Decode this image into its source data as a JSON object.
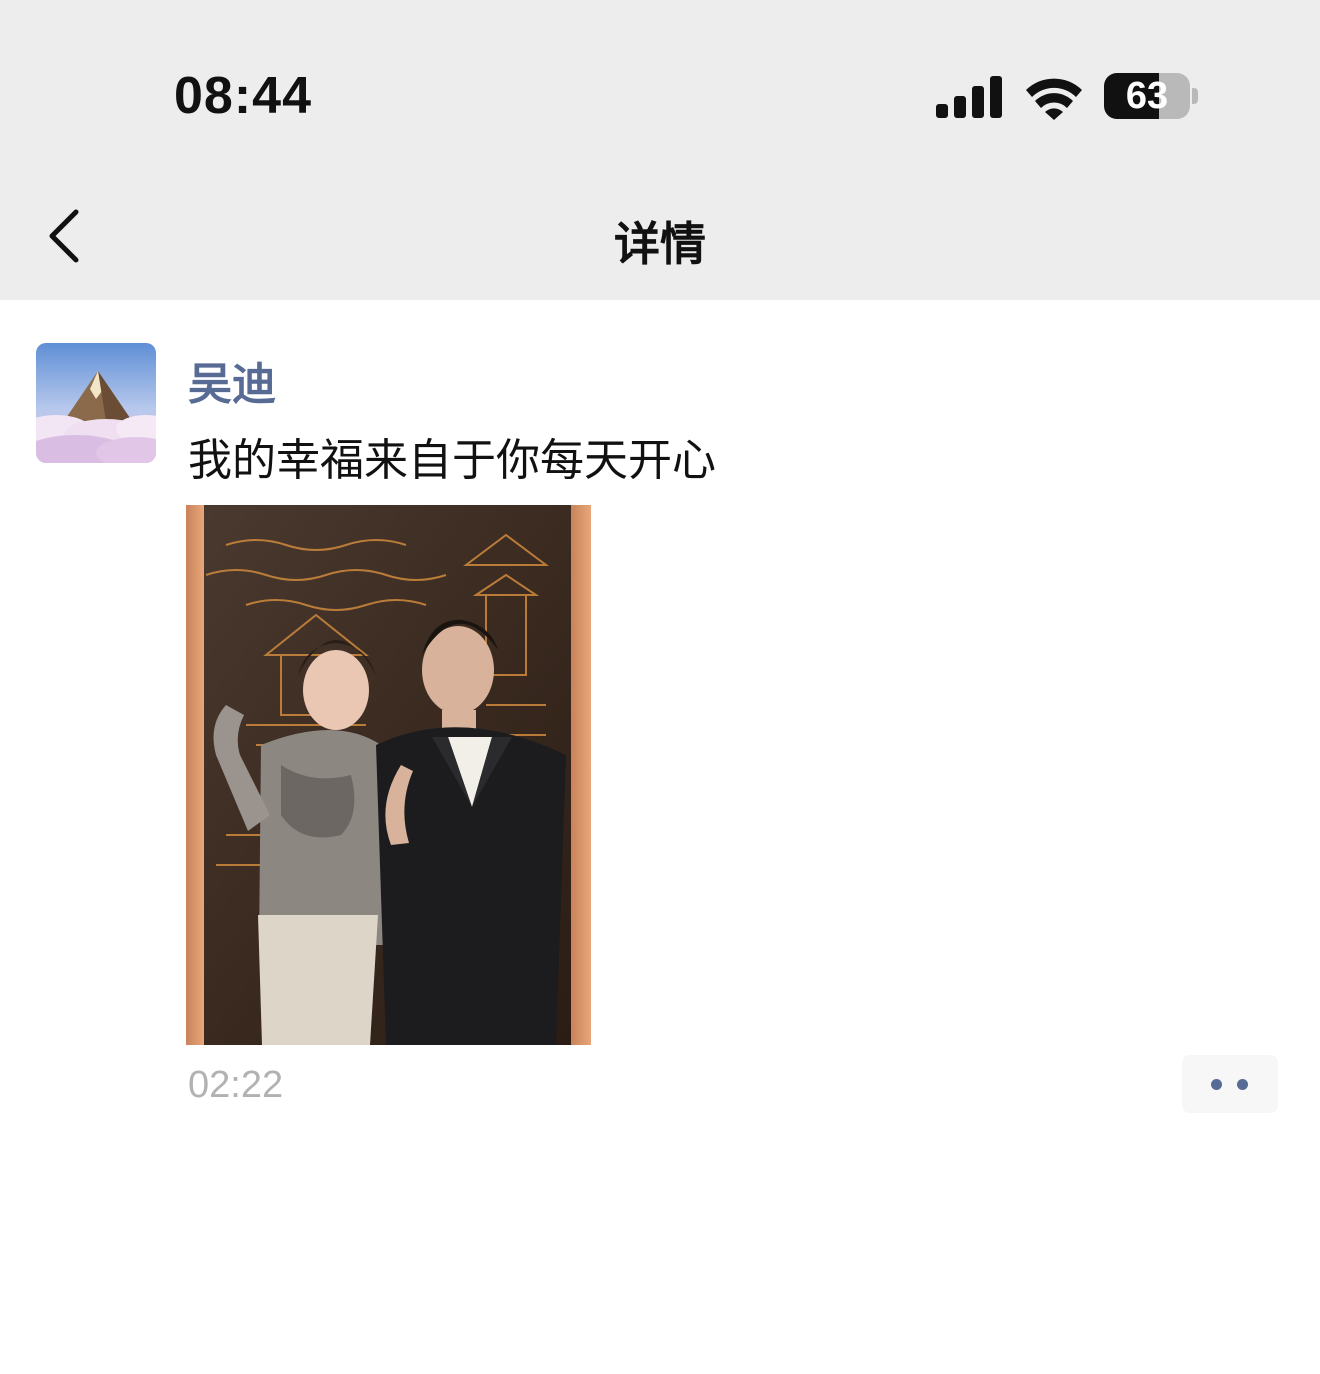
{
  "status_bar": {
    "time": "08:44",
    "battery_level": "63",
    "battery_fraction": 0.63,
    "icons": [
      "signal-icon",
      "wifi-icon",
      "battery-icon"
    ]
  },
  "nav": {
    "back_icon": "chevron-left-icon",
    "title": "详情"
  },
  "post": {
    "avatar_icon": "mountain-clouds-avatar",
    "author": "吴迪",
    "text": "我的幸福来自于你每天开心",
    "image_description_icon": "photo-two-people-icon",
    "time": "02:22",
    "more_icon": "more-dots-icon"
  },
  "colors": {
    "nav_background": "#ededed",
    "author_link": "#576b95",
    "timestamp": "#b2b2b2",
    "more_button_bg": "#f7f7f7"
  }
}
